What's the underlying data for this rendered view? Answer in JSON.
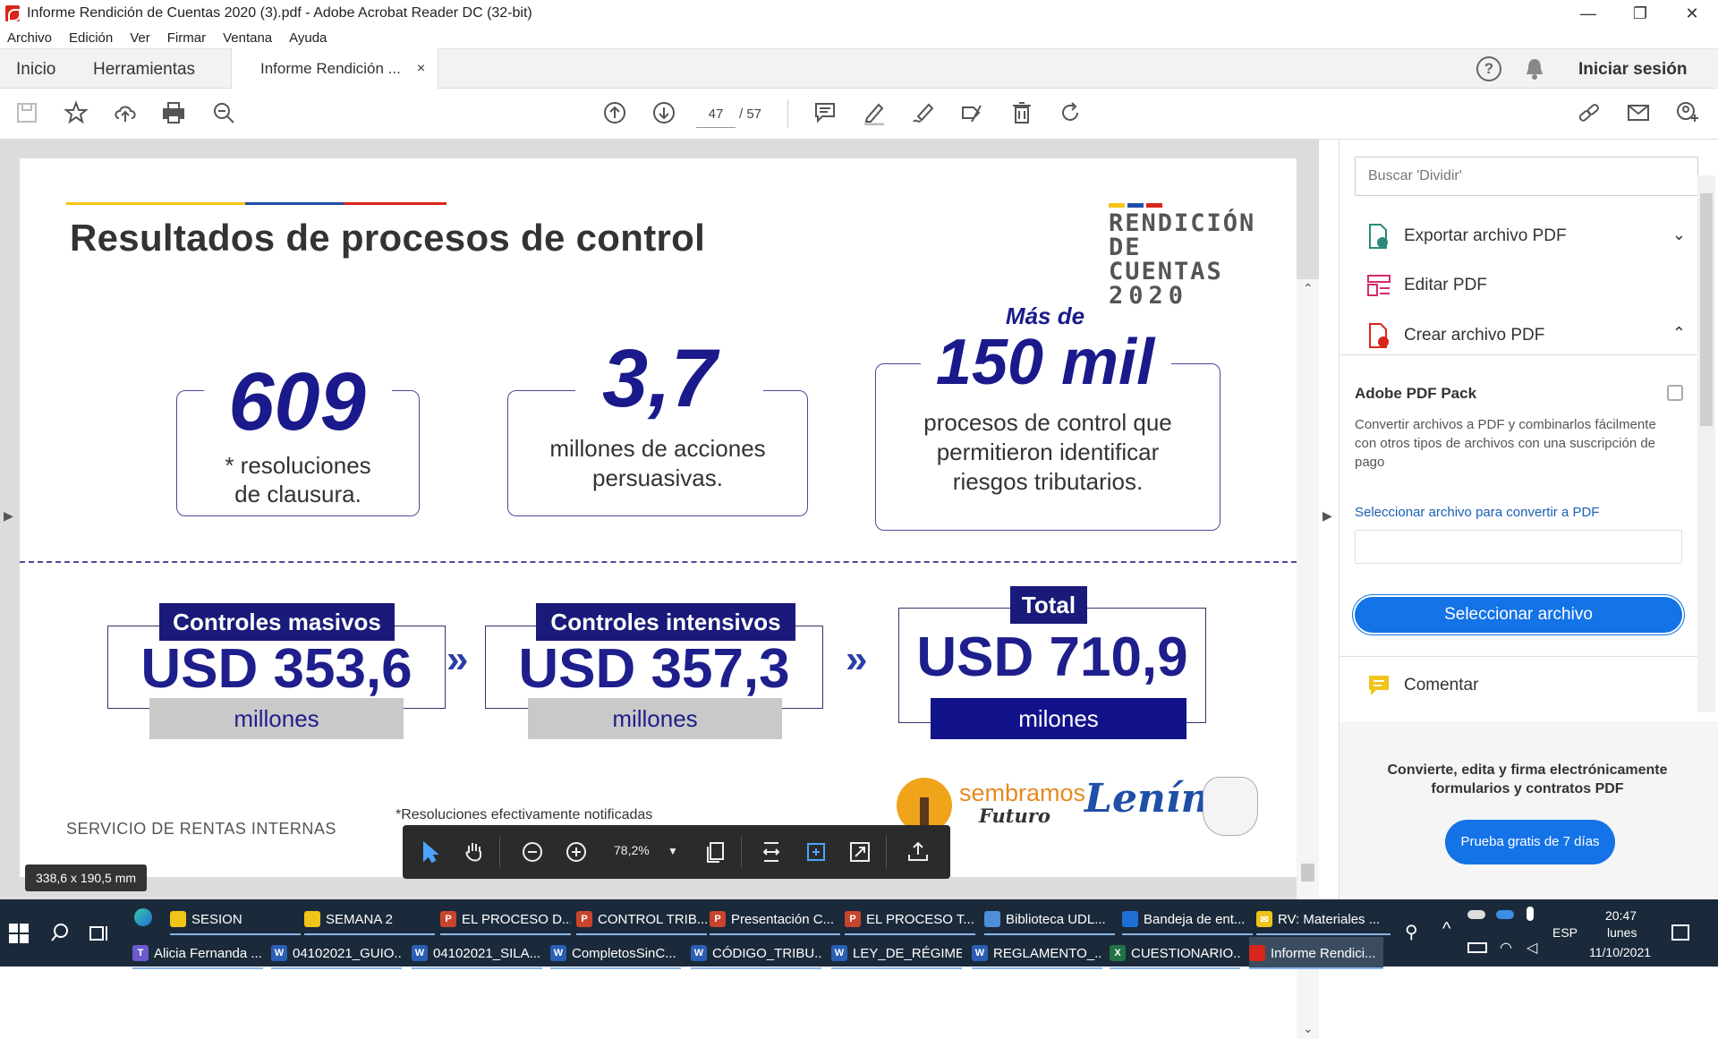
{
  "window": {
    "title": "Informe Rendición de Cuentas 2020 (3).pdf - Adobe Acrobat Reader DC (32-bit)",
    "minimize": "—",
    "restore": "❐",
    "close": "✕"
  },
  "menu": [
    "Archivo",
    "Edición",
    "Ver",
    "Firmar",
    "Ventana",
    "Ayuda"
  ],
  "tabs": {
    "home": "Inicio",
    "tools": "Herramientas",
    "doc": "Informe Rendición ...",
    "doc_close": "×",
    "signin": "Iniciar sesión"
  },
  "toolbar": {
    "page_current": "47",
    "page_total": "/ 57"
  },
  "doc": {
    "heading": "Resultados de procesos de control",
    "logo_line1": "RENDICIÓN",
    "logo_line2": "DE CUENTAS",
    "logo_line3": "2020",
    "stat1_value": "609",
    "stat1_desc_1": "* resoluciones",
    "stat1_desc_2": "de  clausura.",
    "stat2_value": "3,7",
    "stat2_desc_1": "millones de acciones",
    "stat2_desc_2": "persuasivas.",
    "stat3_prefix": "Más de",
    "stat3_value": "150 mil",
    "stat3_desc_1": "procesos de control que",
    "stat3_desc_2": "permitieron identificar",
    "stat3_desc_3": "riesgos tributarios.",
    "ctl1_label": "Controles masivos",
    "ctl1_value": "USD 353,6",
    "ctl1_unit": "millones",
    "ctl2_label": "Controles intensivos",
    "ctl2_value": "USD 357,3",
    "ctl2_unit": "millones",
    "ctl3_label": "Total",
    "ctl3_value": "USD 710,9",
    "ctl3_unit": "milones",
    "chevron": "»",
    "footer_sri": "SERVICIO DE RENTAS INTERNAS",
    "footer_note": "*Resoluciones  efectivamente notificadas",
    "logo_sembramos_1": "sembramos",
    "logo_sembramos_2": "Futuro",
    "logo_lenin": "Lenín",
    "flag_colors": [
      "#f5c518",
      "#1f4fa6",
      "#d9261c"
    ]
  },
  "floatbar": {
    "zoom": "78,2%"
  },
  "dims_tooltip": "338,6 x 190,5 mm",
  "rightpanel": {
    "search_placeholder": "Buscar 'Dividir'",
    "export": "Exportar archivo PDF",
    "edit": "Editar PDF",
    "create": "Crear archivo PDF",
    "pack_title": "Adobe PDF Pack",
    "pack_text": "Convertir archivos a PDF y combinarlos fácilmente con otros tipos de archivos con una suscripción de pago",
    "select_link": "Seleccionar archivo para convertir a PDF",
    "select_btn": "Seleccionar archivo",
    "comment": "Comentar",
    "promo": "Convierte, edita y firma electrónicamente formularios y contratos PDF",
    "trial": "Prueba gratis de 7 días"
  },
  "taskbar": {
    "row1": [
      "SESION",
      "SEMANA 2",
      "EL PROCESO D...",
      "CONTROL TRIB...",
      "Presentación C...",
      "EL PROCESO T...",
      "Biblioteca UDL...",
      "Bandeja de ent...",
      "RV: Materiales ..."
    ],
    "row2": [
      "Alicia Fernanda ...",
      "04102021_GUIO...",
      "04102021_SILA...",
      "CompletosSinC...",
      "CÓDIGO_TRIBU...",
      "LEY_DE_RÉGIME...",
      "REGLAMENTO_...",
      "CUESTIONARIO...",
      "Informe Rendici..."
    ],
    "lang": "ESP",
    "time": "20:47",
    "day": "lunes",
    "date": "11/10/2021"
  }
}
